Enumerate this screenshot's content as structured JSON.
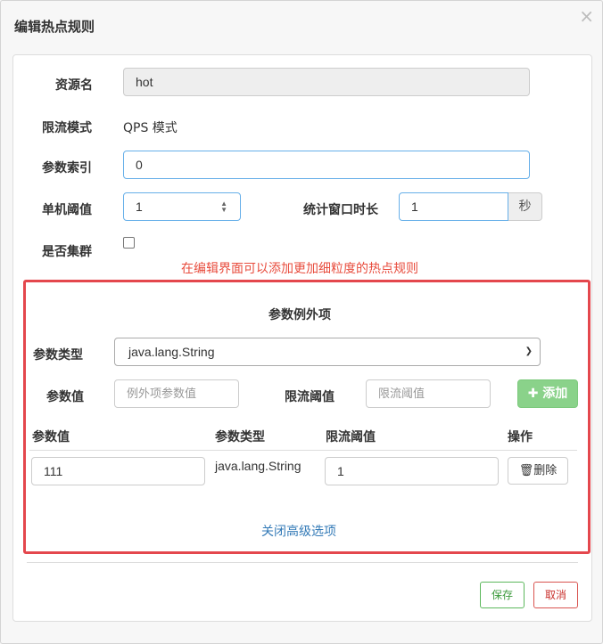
{
  "dialog": {
    "title": "编辑热点规则",
    "close_label": "×"
  },
  "form": {
    "resource_label": "资源名",
    "resource_value": "hot",
    "mode_label": "限流模式",
    "mode_value": "QPS 模式",
    "param_index_label": "参数索引",
    "param_index_value": "0",
    "threshold_label": "单机阈值",
    "threshold_value": "1",
    "window_label": "统计窗口时长",
    "window_value": "1",
    "window_unit": "秒",
    "cluster_label": "是否集群",
    "cluster_checked": false
  },
  "annotation": "在编辑界面可以添加更加细粒度的热点规则",
  "exceptions": {
    "title": "参数例外项",
    "type_label": "参数类型",
    "type_selected": "java.lang.String",
    "value_label": "参数值",
    "value_placeholder": "例外项参数值",
    "limit_label": "限流阈值",
    "limit_placeholder": "限流阈值",
    "add_label": "✚ 添加",
    "columns": [
      "参数值",
      "参数类型",
      "限流阈值",
      "操作"
    ],
    "rows": [
      {
        "value": "111",
        "type": "java.lang.String",
        "limit": "1",
        "action": "删除"
      }
    ],
    "close_advanced": "关闭高级选项"
  },
  "footer": {
    "save_label": "保存",
    "cancel_label": "取消"
  }
}
